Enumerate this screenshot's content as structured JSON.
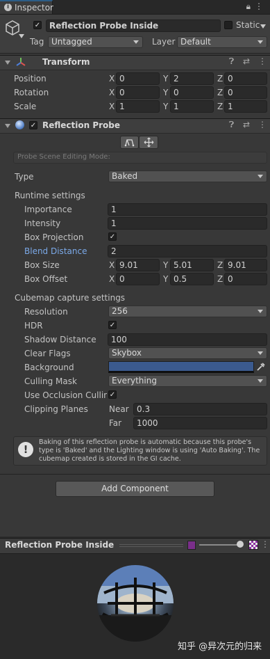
{
  "tab": {
    "title": "Inspector"
  },
  "header": {
    "object_name": "Reflection Probe Inside",
    "static_label": "Static",
    "tag_label": "Tag",
    "tag_value": "Untagged",
    "layer_label": "Layer",
    "layer_value": "Default"
  },
  "transform": {
    "title": "Transform",
    "rows": [
      {
        "label": "Position",
        "x": "0",
        "y": "2",
        "z": "0"
      },
      {
        "label": "Rotation",
        "x": "0",
        "y": "0",
        "z": "0"
      },
      {
        "label": "Scale",
        "x": "1",
        "y": "1",
        "z": "1"
      }
    ]
  },
  "probe": {
    "title": "Reflection Probe",
    "editing_mode": "Probe Scene Editing Mode:",
    "type_label": "Type",
    "type_value": "Baked",
    "runtime_heading": "Runtime settings",
    "importance_label": "Importance",
    "importance_value": "1",
    "intensity_label": "Intensity",
    "intensity_value": "1",
    "box_projection_label": "Box Projection",
    "blend_distance_label": "Blend Distance",
    "blend_distance_value": "2",
    "box_size_label": "Box Size",
    "box_size": {
      "x": "9.01",
      "y": "5.01",
      "z": "9.01"
    },
    "box_offset_label": "Box Offset",
    "box_offset": {
      "x": "0",
      "y": "0.5",
      "z": "0"
    },
    "cubemap_heading": "Cubemap capture settings",
    "resolution_label": "Resolution",
    "resolution_value": "256",
    "hdr_label": "HDR",
    "shadow_distance_label": "Shadow Distance",
    "shadow_distance_value": "100",
    "clear_flags_label": "Clear Flags",
    "clear_flags_value": "Skybox",
    "background_label": "Background",
    "background_color": "#3b5a8e",
    "culling_mask_label": "Culling Mask",
    "culling_mask_value": "Everything",
    "occlusion_label": "Use Occlusion Culling",
    "clipping_label": "Clipping Planes",
    "near_label": "Near",
    "near_value": "0.3",
    "far_label": "Far",
    "far_value": "1000",
    "help_text": "Baking of this reflection probe is automatic because this probe's type is 'Baked' and the Lighting window is using 'Auto Baking'. The cubemap created is stored in the GI cache."
  },
  "add_component_label": "Add Component",
  "preview": {
    "title": "Reflection Probe Inside"
  },
  "watermark": "知乎 @异次元的归来",
  "colors": {
    "accent_blue": "#7ba9e8",
    "background_swatch": "#3b5a8e"
  },
  "axes": {
    "x": "X",
    "y": "Y",
    "z": "Z"
  }
}
